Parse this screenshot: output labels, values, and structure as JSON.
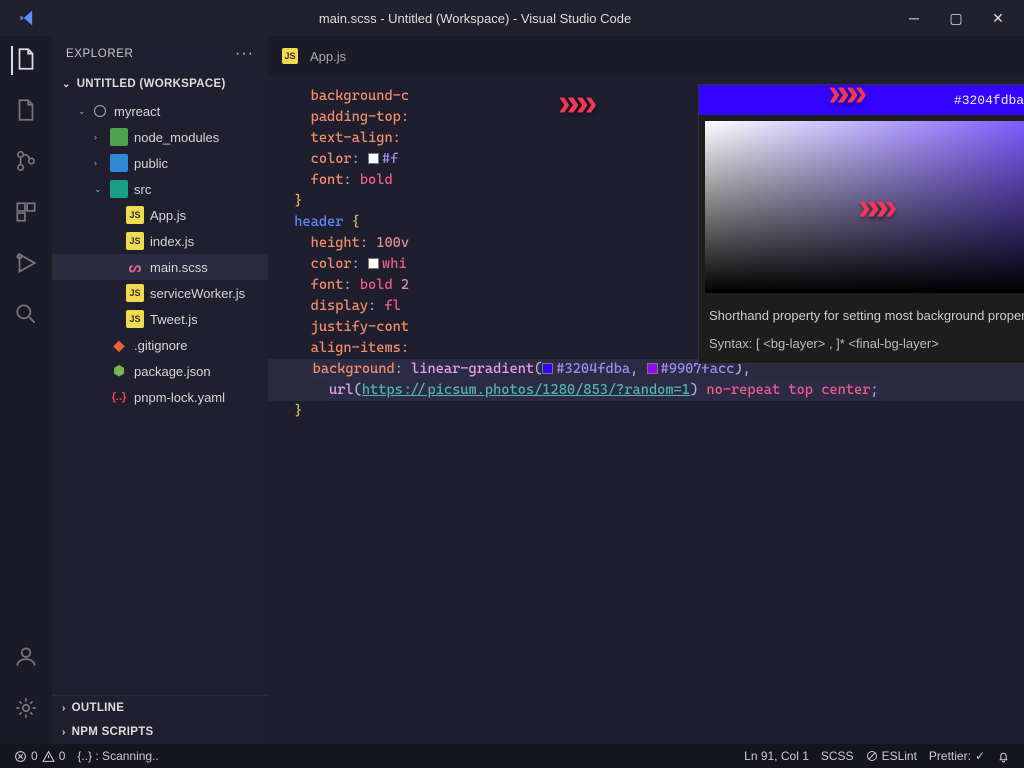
{
  "title": "main.scss - Untitled (Workspace) - Visual Studio Code",
  "sidebar": {
    "header": "EXPLORER",
    "workspace_label": "UNTITLED (WORKSPACE)",
    "outline_label": "OUTLINE",
    "npm_label": "NPM SCRIPTS",
    "tree": {
      "myreact": "myreact",
      "node_modules": "node_modules",
      "public": "public",
      "src": "src",
      "appjs": "App.js",
      "indexjs": "index.js",
      "mainscss": "main.scss",
      "serviceworker": "serviceWorker.js",
      "tweetjs": "Tweet.js",
      "gitignore": ".gitignore",
      "packagejson": "package.json",
      "pnpmlock": "pnpm-lock.yaml"
    }
  },
  "tabs": {
    "appjs": "App.js"
  },
  "color_picker": {
    "header": "#3204fdba",
    "desc": "Shorthand property for setting most background properties at the same place in the style sheet.",
    "syntax": "Syntax: [ <bg-layer> , ]* <final-bg-layer>"
  },
  "code": {
    "l1a": "background-c",
    "l2a": "padding-top:",
    "l3a": "text-align:",
    "l4a": "color",
    "l4b": "#f",
    "l5a": "font",
    "l5b": "bold",
    "l6a": "}",
    "l7a": "header",
    "l7b": " {",
    "l8a": "height",
    "l8b": "100v",
    "l9a": "color",
    "l9b": "whi",
    "l10a": "font",
    "l10b": "bold",
    "l10c": "2",
    "l11a": "display",
    "l11b": "fl",
    "l12a": "justify-cont",
    "l13a": "align-items:",
    "bg_prop": "background",
    "grad_fn": "linear-gradient",
    "color1": "#3204fdba",
    "color2": "#9907facc",
    "url_kw": "url",
    "url_val": "https://picsum.photos/1280/853/?random=1",
    "tail": " no-repeat top center",
    "lclose": "}"
  },
  "status": {
    "errors": "0",
    "warnings": "0",
    "scanning": "{..} : Scanning..",
    "ln_col": "Ln 91, Col 1",
    "lang": "SCSS",
    "eslint": "ESLint",
    "prettier": "Prettier: "
  }
}
